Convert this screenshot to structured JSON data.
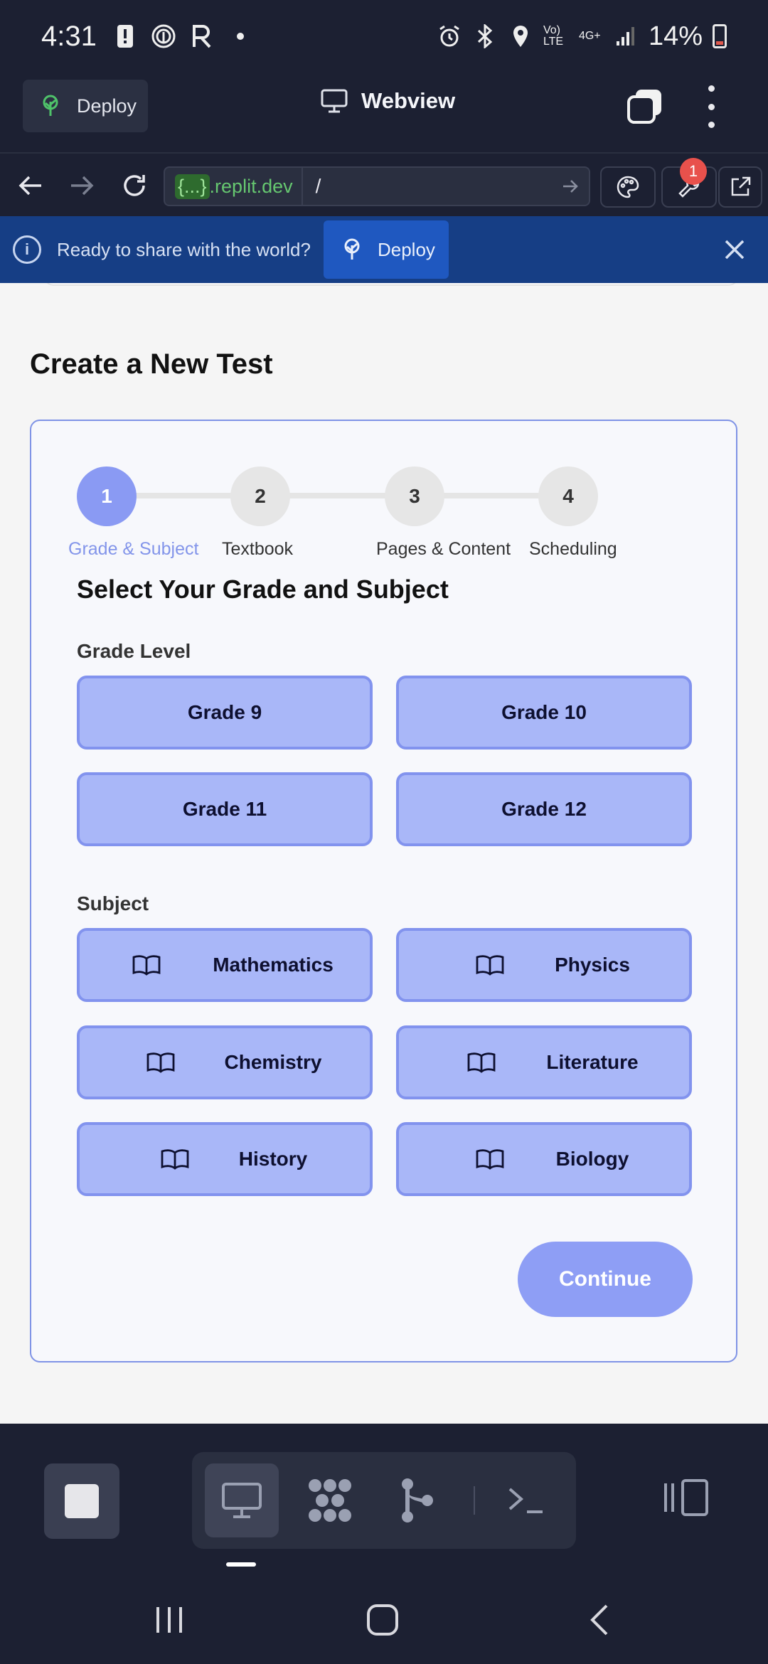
{
  "status_bar": {
    "time": "4:31",
    "signal_text": "Vo) LTE",
    "network": "4G+",
    "battery": "14%"
  },
  "app_header": {
    "deploy_label": "Deploy",
    "title": "Webview"
  },
  "url_bar": {
    "host_var": "{...}",
    "host_suffix": ".replit.dev",
    "path": "/",
    "notification_count": "1"
  },
  "banner": {
    "message": "Ready to share with the world?",
    "deploy_label": "Deploy"
  },
  "page": {
    "title": "Create a New Test"
  },
  "stepper": {
    "steps": [
      {
        "number": "1",
        "label": "Grade & Subject",
        "active": true
      },
      {
        "number": "2",
        "label": "Textbook",
        "active": false
      },
      {
        "number": "3",
        "label": "Pages & Content",
        "active": false
      },
      {
        "number": "4",
        "label": "Scheduling",
        "active": false
      }
    ]
  },
  "form": {
    "section_title": "Select Your Grade and Subject",
    "grade_label": "Grade Level",
    "grades": [
      "Grade 9",
      "Grade 10",
      "Grade 11",
      "Grade 12"
    ],
    "subject_label": "Subject",
    "subjects": [
      "Mathematics",
      "Physics",
      "Chemistry",
      "Literature",
      "History",
      "Biology"
    ],
    "continue_label": "Continue"
  },
  "colors": {
    "accent": "#8a9af3",
    "option_fill": "#a9b7f8",
    "banner": "#163e85",
    "chrome": "#1c2032"
  }
}
